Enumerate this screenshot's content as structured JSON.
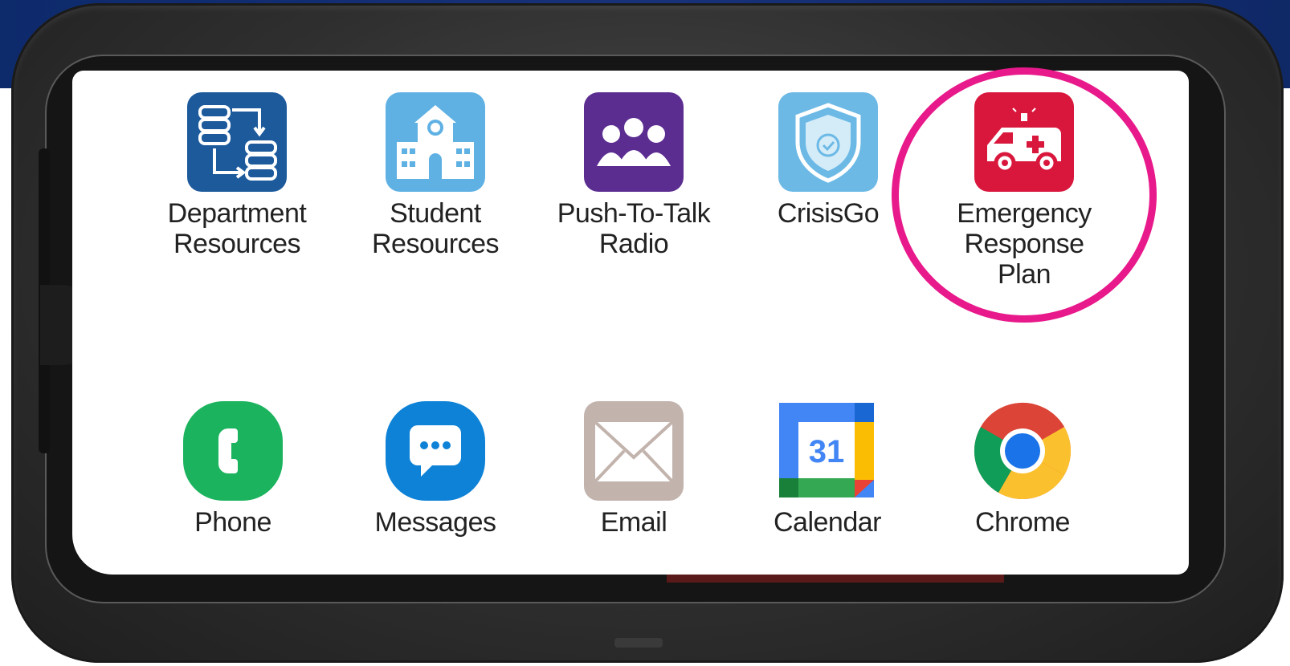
{
  "apps_row1": [
    {
      "id": "department-resources",
      "label": "Department\nResources",
      "icon": "database-sync-icon",
      "color": "#1c5a9c"
    },
    {
      "id": "student-resources",
      "label": "Student\nResources",
      "icon": "school-building-icon",
      "color": "#5fb1e4"
    },
    {
      "id": "push-to-talk-radio",
      "label": "Push-To-Talk\nRadio",
      "icon": "group-people-icon",
      "color": "#5c2d91"
    },
    {
      "id": "crisisgo",
      "label": "CrisisGo",
      "icon": "shield-check-icon",
      "color": "#6cb9e6"
    },
    {
      "id": "emergency-response-plan",
      "label": "Emergency\nResponse\nPlan",
      "icon": "ambulance-icon",
      "color": "#d9173c"
    }
  ],
  "apps_row2": [
    {
      "id": "phone",
      "label": "Phone",
      "icon": "phone-icon",
      "color": "#1cb35e"
    },
    {
      "id": "messages",
      "label": "Messages",
      "icon": "chat-bubble-icon",
      "color": "#0e82d6"
    },
    {
      "id": "email",
      "label": "Email",
      "icon": "envelope-icon",
      "color": "#c2b3ad"
    },
    {
      "id": "calendar",
      "label": "Calendar",
      "icon": "calendar-icon",
      "color": "#4285f4",
      "day": "31"
    },
    {
      "id": "chrome",
      "label": "Chrome",
      "icon": "chrome-icon",
      "color": "#4285f4"
    }
  ],
  "highlight": {
    "target": "emergency-response-plan",
    "color": "#e8198b"
  }
}
